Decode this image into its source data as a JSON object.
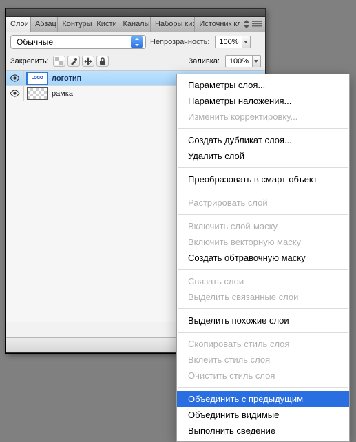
{
  "tabs": [
    "Слои",
    "Абзац",
    "Контуры",
    "Кисти",
    "Каналы",
    "Наборы кис",
    "Источник кл"
  ],
  "active_tab_index": 0,
  "blend_mode": "Обычные",
  "opacity": {
    "label": "Непрозрачность:",
    "value": "100%"
  },
  "fill": {
    "label": "Заливка:",
    "value": "100%"
  },
  "lock_label": "Закрепить:",
  "lock_icons": [
    "transparency-lock-icon",
    "brush-lock-icon",
    "move-lock-icon",
    "lock-all-icon"
  ],
  "layers": [
    {
      "name": "логотип",
      "visible": true,
      "selected": true,
      "thumb": "logo"
    },
    {
      "name": "рамка",
      "visible": true,
      "selected": false,
      "thumb": "checker"
    }
  ],
  "footer_icons": [
    "link-icon",
    "fx-icon",
    "mask-icon",
    "adjust-icon"
  ],
  "context_menu": [
    {
      "label": "Параметры слоя...",
      "enabled": true
    },
    {
      "label": "Параметры наложения...",
      "enabled": true
    },
    {
      "label": "Изменить корректировку...",
      "enabled": false
    },
    {
      "sep": true
    },
    {
      "label": "Создать дубликат слоя...",
      "enabled": true
    },
    {
      "label": "Удалить слой",
      "enabled": true
    },
    {
      "sep": true
    },
    {
      "label": "Преобразовать в смарт-объект",
      "enabled": true
    },
    {
      "sep": true
    },
    {
      "label": "Растрировать слой",
      "enabled": false
    },
    {
      "sep": true
    },
    {
      "label": "Включить слой-маску",
      "enabled": false
    },
    {
      "label": "Включить векторную маску",
      "enabled": false
    },
    {
      "label": "Создать обтравочную маску",
      "enabled": true
    },
    {
      "sep": true
    },
    {
      "label": "Связать слои",
      "enabled": false
    },
    {
      "label": "Выделить связанные слои",
      "enabled": false
    },
    {
      "sep": true
    },
    {
      "label": "Выделить похожие слои",
      "enabled": true
    },
    {
      "sep": true
    },
    {
      "label": "Скопировать стиль слоя",
      "enabled": false
    },
    {
      "label": "Вклеить стиль слоя",
      "enabled": false
    },
    {
      "label": "Очистить стиль слоя",
      "enabled": false
    },
    {
      "sep": true
    },
    {
      "label": "Объединить с предыдущим",
      "enabled": true,
      "highlight": true
    },
    {
      "label": "Объединить видимые",
      "enabled": true
    },
    {
      "label": "Выполнить сведение",
      "enabled": true
    }
  ]
}
